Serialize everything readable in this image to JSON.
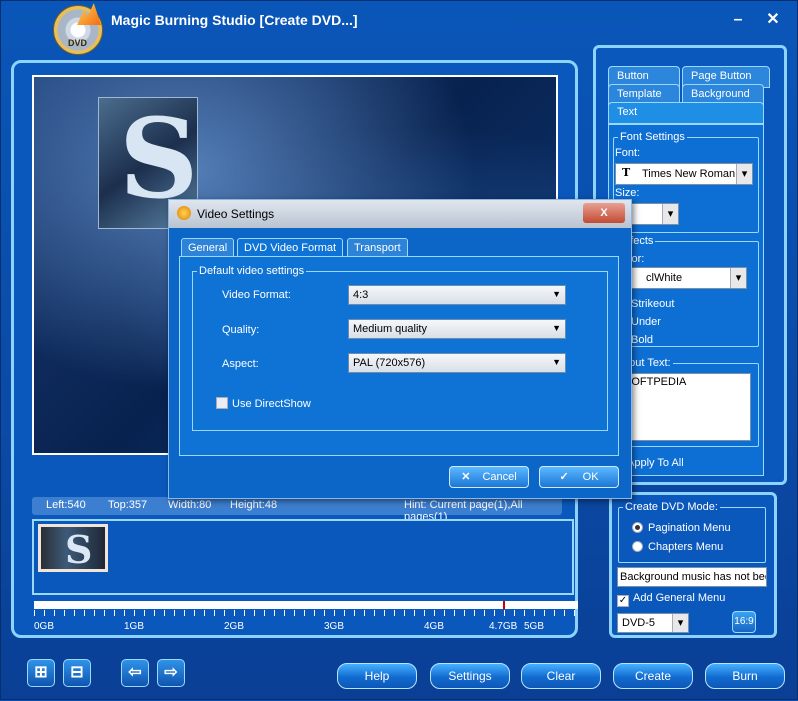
{
  "window": {
    "title": "Magic Burning Studio [Create DVD...]",
    "logo_text": "DVD",
    "minimize_glyph": "–",
    "close_glyph": "✕"
  },
  "status": {
    "left": "Left:540",
    "top": "Top:357",
    "width": "Width:80",
    "height": "Height:48",
    "hint": "Hint: Current page(1),All pages(1)"
  },
  "timeline": {
    "labels": [
      "0GB",
      "1GB",
      "2GB",
      "3GB",
      "4GB",
      "4.7GB",
      "5GB"
    ],
    "used_fraction": 0.0
  },
  "right_panel": {
    "tabs": [
      "Button",
      "Page Button",
      "Template",
      "Background",
      "Text"
    ],
    "font_settings_legend": "Font Settings",
    "font_label": "Font:",
    "font_value": "Times New Roman",
    "size_label": "Size:",
    "effects_legend": "Effects",
    "color_label": "Color:",
    "color_value": "clWhite",
    "strikeout": "Strikeout",
    "underline": "Under",
    "bold": "Bold",
    "input_text_label": "Input Text:",
    "input_text_value": "SOFTPEDIA",
    "apply_to_all": "Apply To All"
  },
  "dvd_mode": {
    "legend": "Create DVD Mode:",
    "pagination": "Pagination Menu",
    "chapters": "Chapters Menu",
    "music_status": "Background music has not bee",
    "add_general_menu": "Add General Menu",
    "disc_type": "DVD-5",
    "aspect_button": "16:9"
  },
  "toolbar": {
    "help": "Help",
    "settings": "Settings",
    "clear": "Clear",
    "create": "Create",
    "burn": "Burn"
  },
  "dialog": {
    "title": "Video Settings",
    "close_glyph": "X",
    "tabs": [
      "General",
      "DVD Video Format",
      "Transport"
    ],
    "group_legend": "Default video settings",
    "video_format_label": "Video Format:",
    "video_format_value": "4:3",
    "quality_label": "Quality:",
    "quality_value": "Medium quality",
    "aspect_label": "Aspect:",
    "aspect_value": "PAL (720x576)",
    "directshow_label": "Use DirectShow",
    "cancel": "Cancel",
    "ok": "OK"
  }
}
